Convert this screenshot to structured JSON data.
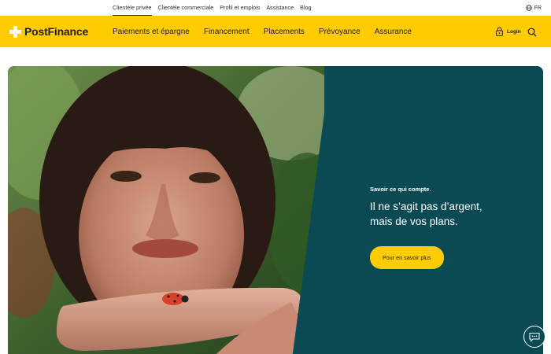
{
  "topbar": {
    "links": [
      "Clientèle privée",
      "Clientèle commerciale",
      "Profil et emplois",
      "Assistance",
      "Blog"
    ],
    "language": "FR"
  },
  "header": {
    "brand": "PostFinance",
    "nav": [
      "Paiements et épargne",
      "Financement",
      "Placements",
      "Prévoyance",
      "Assurance"
    ],
    "login_label": "Login"
  },
  "hero": {
    "eyebrow": "Savoir ce qui compte.",
    "headline_line1": "Il ne s’agit pas d’argent,",
    "headline_line2": "mais de vos plans.",
    "cta_label": "Pour en savoir plus"
  },
  "colors": {
    "brand_yellow": "#ffcc00",
    "hero_teal": "#0b4a52"
  }
}
